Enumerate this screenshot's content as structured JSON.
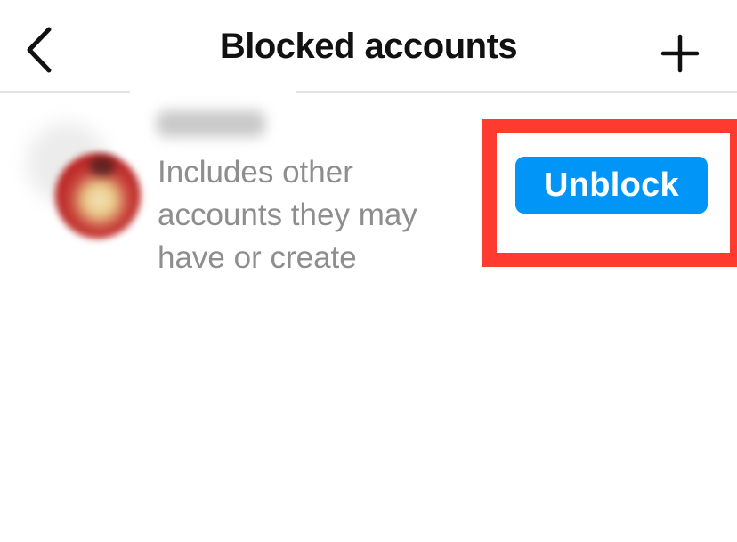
{
  "header": {
    "title": "Blocked accounts",
    "back_icon": "chevron-left-icon",
    "add_icon": "plus-icon"
  },
  "blocked_list": [
    {
      "username": "",
      "description": "Includes other accounts they may have or create",
      "action_label": "Unblock"
    }
  ],
  "colors": {
    "accent": "#0095f6",
    "highlight": "#ff3b30",
    "secondary_text": "#8e8e8e"
  }
}
